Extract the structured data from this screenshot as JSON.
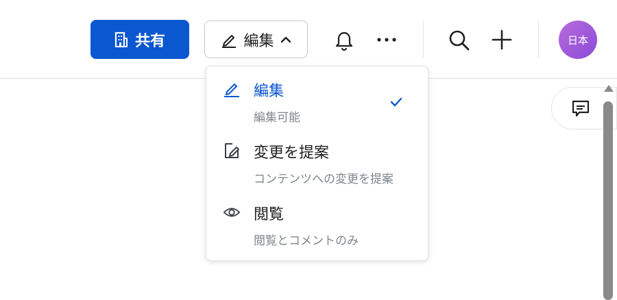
{
  "toolbar": {
    "share_label": "共有",
    "share_icon": "building-icon",
    "mode_label": "編集",
    "mode_icon": "pencil-icon",
    "mode_chevron": "chevron-up-icon",
    "avatar_text": "日本"
  },
  "mode_menu": {
    "items": [
      {
        "title": "編集",
        "subtitle": "編集可能",
        "icon": "pencil-icon",
        "selected": true
      },
      {
        "title": "変更を提案",
        "subtitle": "コンテンツへの変更を提案",
        "icon": "suggest-edit-icon",
        "selected": false
      },
      {
        "title": "閲覧",
        "subtitle": "閲覧とコメントのみ",
        "icon": "eye-icon",
        "selected": false
      }
    ]
  },
  "colors": {
    "accent": "#0b57d0",
    "avatar": "#a35bd9",
    "subtitle": "#80868b"
  }
}
